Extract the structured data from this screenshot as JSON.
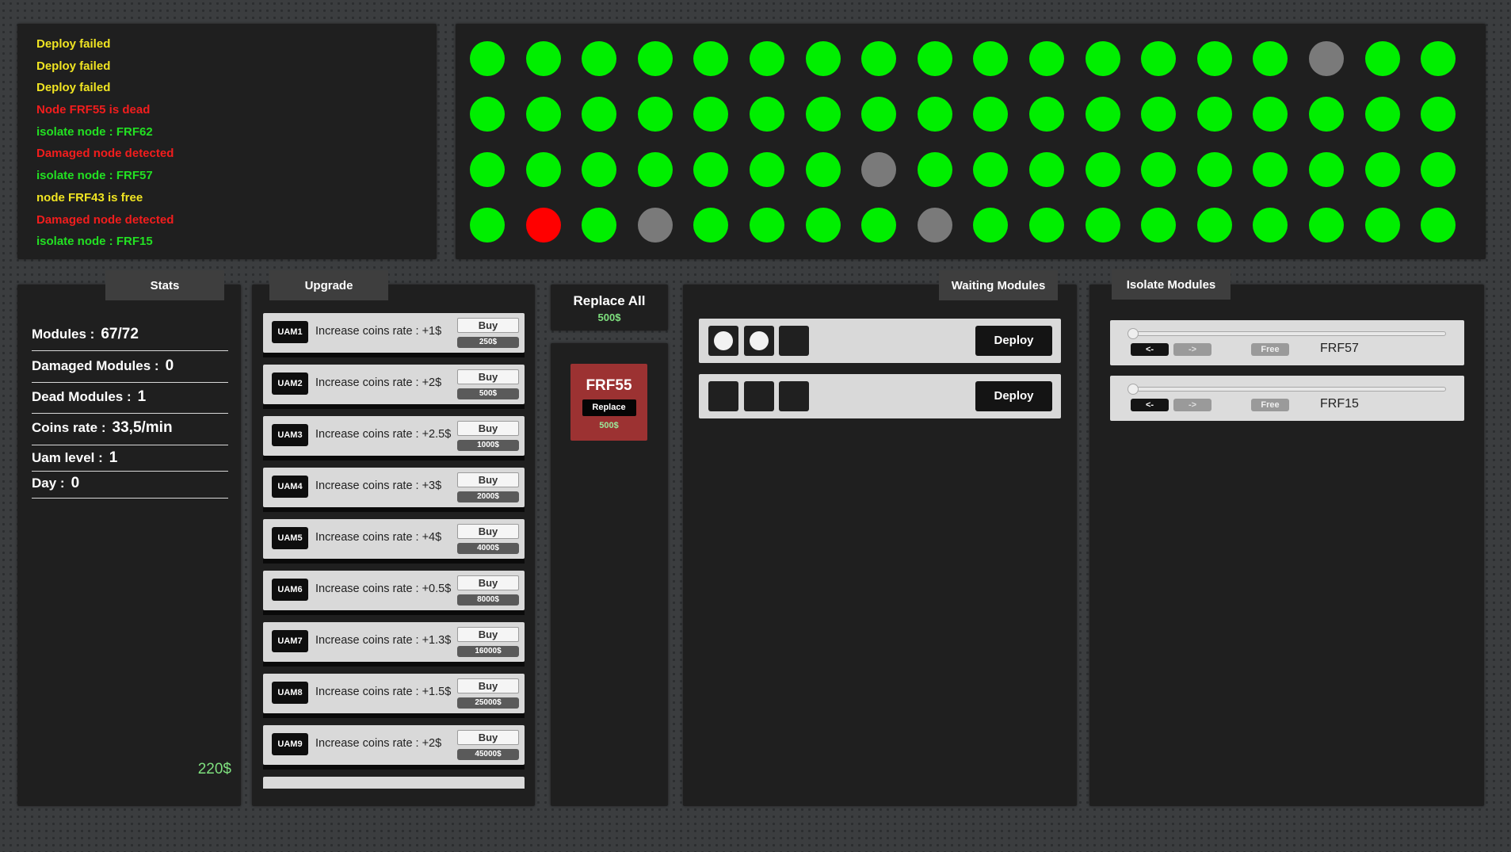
{
  "log": [
    {
      "text": "Deploy failed",
      "color": "#f0e422"
    },
    {
      "text": "Deploy failed",
      "color": "#f0e422"
    },
    {
      "text": "Deploy failed",
      "color": "#f0e422"
    },
    {
      "text": "Node FRF55 is dead",
      "color": "#f21d1d"
    },
    {
      "text": "isolate node : FRF62",
      "color": "#22e022"
    },
    {
      "text": "Damaged node detected",
      "color": "#f21d1d"
    },
    {
      "text": "isolate node : FRF57",
      "color": "#22e022"
    },
    {
      "text": "node FRF43 is free",
      "color": "#f0e422"
    },
    {
      "text": "Damaged node detected",
      "color": "#f21d1d"
    },
    {
      "text": "isolate node : FRF15",
      "color": "#22e022"
    }
  ],
  "node_colors": {
    "ok": "#00ef00",
    "isolated": "#7a7a7a",
    "dead": "#ff0000"
  },
  "nodes": [
    [
      "ok",
      "ok",
      "ok",
      "ok",
      "ok",
      "ok",
      "ok",
      "ok",
      "ok",
      "ok",
      "ok",
      "ok",
      "ok",
      "ok",
      "ok",
      "isolated",
      "ok",
      "ok"
    ],
    [
      "ok",
      "ok",
      "ok",
      "ok",
      "ok",
      "ok",
      "ok",
      "ok",
      "ok",
      "ok",
      "ok",
      "ok",
      "ok",
      "ok",
      "ok",
      "ok",
      "ok",
      "ok"
    ],
    [
      "ok",
      "ok",
      "ok",
      "ok",
      "ok",
      "ok",
      "ok",
      "isolated",
      "ok",
      "ok",
      "ok",
      "ok",
      "ok",
      "ok",
      "ok",
      "ok",
      "ok",
      "ok"
    ],
    [
      "ok",
      "dead",
      "ok",
      "isolated",
      "ok",
      "ok",
      "ok",
      "ok",
      "isolated",
      "ok",
      "ok",
      "ok",
      "ok",
      "ok",
      "ok",
      "ok",
      "ok",
      "ok"
    ]
  ],
  "stats": {
    "tab": "Stats",
    "modules": {
      "label": "Modules :",
      "value": "67/72"
    },
    "damaged": {
      "label": "Damaged Modules :",
      "value": "0"
    },
    "dead": {
      "label": "Dead Modules :",
      "value": "1"
    },
    "rate": {
      "label": "Coins rate :",
      "value": "33,5/min"
    },
    "uam": {
      "label": "Uam level :",
      "value": "1"
    },
    "day": {
      "label": "Day :",
      "value": "0"
    },
    "coins": "220$"
  },
  "upgrade": {
    "tab": "Upgrade",
    "items": [
      {
        "label": "UAM1",
        "text": "Increase coins rate : +1$",
        "buy": "Buy",
        "price": "250$"
      },
      {
        "label": "UAM2",
        "text": "Increase coins rate : +2$",
        "buy": "Buy",
        "price": "500$"
      },
      {
        "label": "UAM3",
        "text": "Increase coins rate : +2.5$",
        "buy": "Buy",
        "price": "1000$"
      },
      {
        "label": "UAM4",
        "text": "Increase coins rate : +3$",
        "buy": "Buy",
        "price": "2000$"
      },
      {
        "label": "UAM5",
        "text": "Increase coins rate : +4$",
        "buy": "Buy",
        "price": "4000$"
      },
      {
        "label": "UAM6",
        "text": "Increase coins rate : +0.5$",
        "buy": "Buy",
        "price": "8000$"
      },
      {
        "label": "UAM7",
        "text": "Increase coins rate : +1.3$",
        "buy": "Buy",
        "price": "16000$"
      },
      {
        "label": "UAM8",
        "text": "Increase coins rate : +1.5$",
        "buy": "Buy",
        "price": "25000$"
      },
      {
        "label": "UAM9",
        "text": "Increase coins rate : +2$",
        "buy": "Buy",
        "price": "45000$"
      }
    ]
  },
  "replace_all": {
    "title": "Replace All",
    "price": "500$"
  },
  "dead_node": {
    "name": "FRF55",
    "button": "Replace",
    "price": "500$"
  },
  "waiting": {
    "tab": "Waiting Modules",
    "rows": [
      {
        "slots": [
          true,
          true,
          false
        ],
        "button": "Deploy"
      },
      {
        "slots": [
          false,
          false,
          false
        ],
        "button": "Deploy"
      }
    ]
  },
  "isolate": {
    "tab": "Isolate Modules",
    "rows": [
      {
        "left": "<-",
        "right": "->",
        "free": "Free",
        "name": "FRF57"
      },
      {
        "left": "<-",
        "right": "->",
        "free": "Free",
        "name": "FRF15"
      }
    ]
  }
}
